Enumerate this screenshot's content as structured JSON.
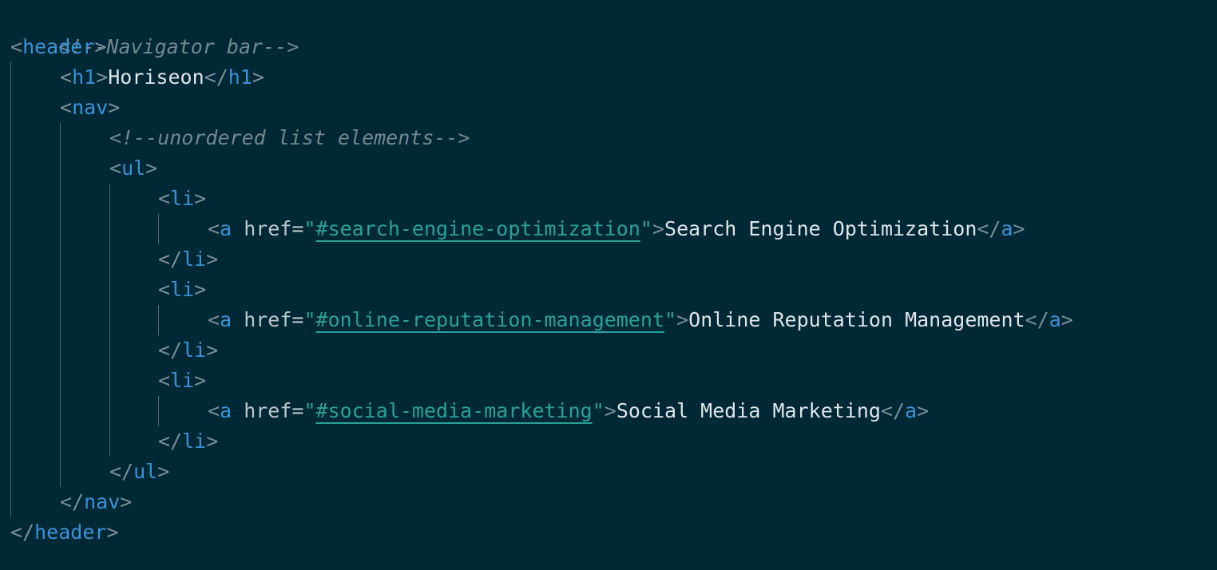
{
  "editor": {
    "colors": {
      "background": "#002835",
      "tag": "#3a92d6",
      "string": "#2aa198",
      "comment": "#75888f",
      "text": "#dfe5e8",
      "punctuation": "#7b8f98",
      "indent_guide": "#4d6670"
    },
    "lines": {
      "l1": {
        "comment": "<!--Navigator bar-->"
      },
      "l2": {
        "open": "<",
        "tag": "header",
        "close": ">"
      },
      "l3": {
        "open": "<",
        "tag": "h1",
        "close": ">",
        "text": "Horiseon",
        "end_open": "</",
        "end_tag": "h1",
        "end_close": ">"
      },
      "l4": {
        "open": "<",
        "tag": "nav",
        "close": ">"
      },
      "l5": {
        "comment": "<!--unordered list elements-->"
      },
      "l6": {
        "open": "<",
        "tag": "ul",
        "close": ">"
      },
      "l7": {
        "open": "<",
        "tag": "li",
        "close": ">"
      },
      "l8": {
        "open": "<",
        "tag": "a",
        "attr": "href=",
        "quote1": "\"",
        "href": "#search-engine-optimization",
        "quote2": "\"",
        "close": ">",
        "text": "Search Engine Optimization",
        "end_open": "</",
        "end_tag": "a",
        "end_close": ">"
      },
      "l9": {
        "open": "</",
        "tag": "li",
        "close": ">"
      },
      "l10": {
        "open": "<",
        "tag": "li",
        "close": ">"
      },
      "l11": {
        "open": "<",
        "tag": "a",
        "attr": "href=",
        "quote1": "\"",
        "href": "#online-reputation-management",
        "quote2": "\"",
        "close": ">",
        "text": "Online Reputation Management",
        "end_open": "</",
        "end_tag": "a",
        "end_close": ">"
      },
      "l12": {
        "open": "</",
        "tag": "li",
        "close": ">"
      },
      "l13": {
        "open": "<",
        "tag": "li",
        "close": ">"
      },
      "l14": {
        "open": "<",
        "tag": "a",
        "attr": "href=",
        "quote1": "\"",
        "href": "#social-media-marketing",
        "quote2": "\"",
        "close": ">",
        "text": "Social Media Marketing",
        "end_open": "</",
        "end_tag": "a",
        "end_close": ">"
      },
      "l15": {
        "open": "</",
        "tag": "li",
        "close": ">"
      },
      "l16": {
        "open": "</",
        "tag": "ul",
        "close": ">"
      },
      "l17": {
        "open": "</",
        "tag": "nav",
        "close": ">"
      },
      "l18": {
        "open": "</",
        "tag": "header",
        "close": ">"
      }
    }
  }
}
